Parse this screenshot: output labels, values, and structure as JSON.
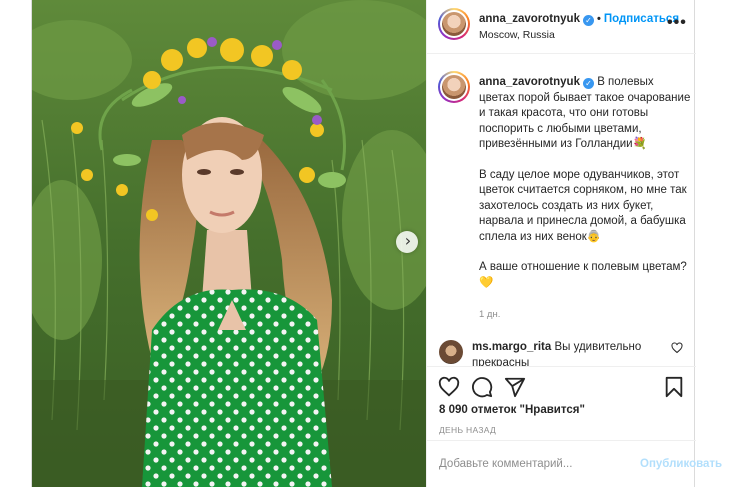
{
  "post": {
    "username": "anna_zavorotnyuk",
    "follow_label": "Подписаться",
    "location": "Moscow, Russia",
    "more_label": "•••",
    "verified_mark": "✓",
    "separator": "•"
  },
  "caption": {
    "username": "anna_zavorotnyuk",
    "paragraph_1": "В полевых цветах порой бывает такое очарование и такая красота, что они готовы поспорить с любыми цветами, привезёнными из Голландии💐",
    "paragraph_2": "В саду целое море одуванчиков, этот цветок считается сорняком, но мне так захотелось создать из них букет, нарвала и принесла домой, а бабушка сплела из них венок👵",
    "paragraph_3": "А ваше отношение к полевым цветам?💛",
    "time": "1 дн."
  },
  "comment": {
    "username": "ms.margo_rita",
    "text": "Вы удивительно прекрасны"
  },
  "actions": {
    "like_icon": "heart-icon",
    "comment_icon": "comment-icon",
    "share_icon": "share-icon",
    "save_icon": "bookmark-icon"
  },
  "likes": "8 090 отметок \"Нравится\"",
  "date": "ДЕНЬ НАЗАД",
  "add_comment": {
    "placeholder": "Добавьте комментарий...",
    "publish_label": "Опубликовать"
  },
  "colors": {
    "accent": "#0095f6",
    "publish_disabled": "#b2dffc",
    "dress": "#1a9a3c",
    "foliage": "#4f7a2e"
  }
}
